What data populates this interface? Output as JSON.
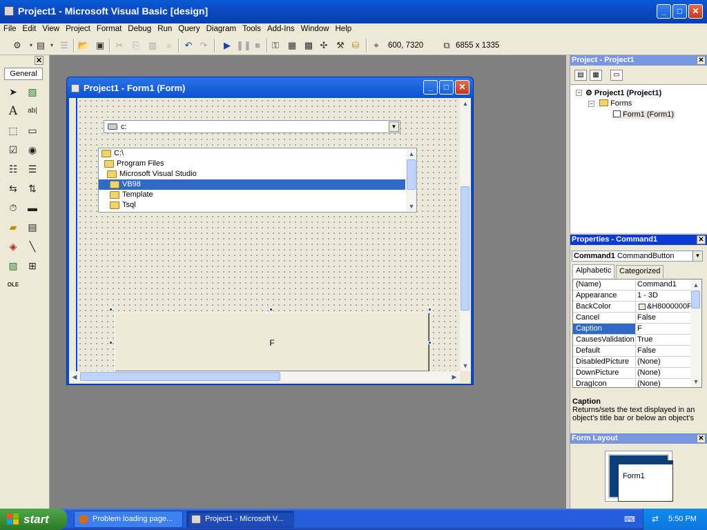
{
  "window": {
    "title": "Project1 - Microsoft Visual Basic [design]"
  },
  "menu": [
    "File",
    "Edit",
    "View",
    "Project",
    "Format",
    "Debug",
    "Run",
    "Query",
    "Diagram",
    "Tools",
    "Add-Ins",
    "Window",
    "Help"
  ],
  "toolbar": {
    "position": "600, 7320",
    "size": "6855 x 1335"
  },
  "toolbox": {
    "tab": "General"
  },
  "form_window": {
    "title": "Project1 - Form1 (Form)",
    "drive": "c:",
    "directories": [
      "C:\\",
      "Program Files",
      "Microsoft Visual Studio",
      "VB98",
      "Template",
      "Tsql"
    ],
    "selected_directory": "VB98",
    "command_caption": "F"
  },
  "project_panel": {
    "title": "Project - Project1",
    "project": "Project1 (Project1)",
    "folder": "Forms",
    "form": "Form1 (Form1)"
  },
  "properties_panel": {
    "title": "Properties - Command1",
    "object_name": "Command1",
    "object_type": "CommandButton",
    "tabs": [
      "Alphabetic",
      "Categorized"
    ],
    "rows": [
      {
        "name": "(Name)",
        "value": "Command1"
      },
      {
        "name": "Appearance",
        "value": "1 - 3D"
      },
      {
        "name": "BackColor",
        "value": "&H8000000F"
      },
      {
        "name": "Cancel",
        "value": "False"
      },
      {
        "name": "Caption",
        "value": "F"
      },
      {
        "name": "CausesValidation",
        "value": "True"
      },
      {
        "name": "Default",
        "value": "False"
      },
      {
        "name": "DisabledPicture",
        "value": "(None)"
      },
      {
        "name": "DownPicture",
        "value": "(None)"
      },
      {
        "name": "DragIcon",
        "value": "(None)"
      }
    ],
    "selected_row": "Caption",
    "desc_title": "Caption",
    "desc_text": "Returns/sets the text displayed in an object's title bar or below an object's"
  },
  "layout_panel": {
    "title": "Form Layout",
    "form_label": "Form1"
  },
  "taskbar": {
    "start": "start",
    "items": [
      "Problem loading page...",
      "Project1 - Microsoft V..."
    ],
    "clock": "5:50 PM"
  }
}
